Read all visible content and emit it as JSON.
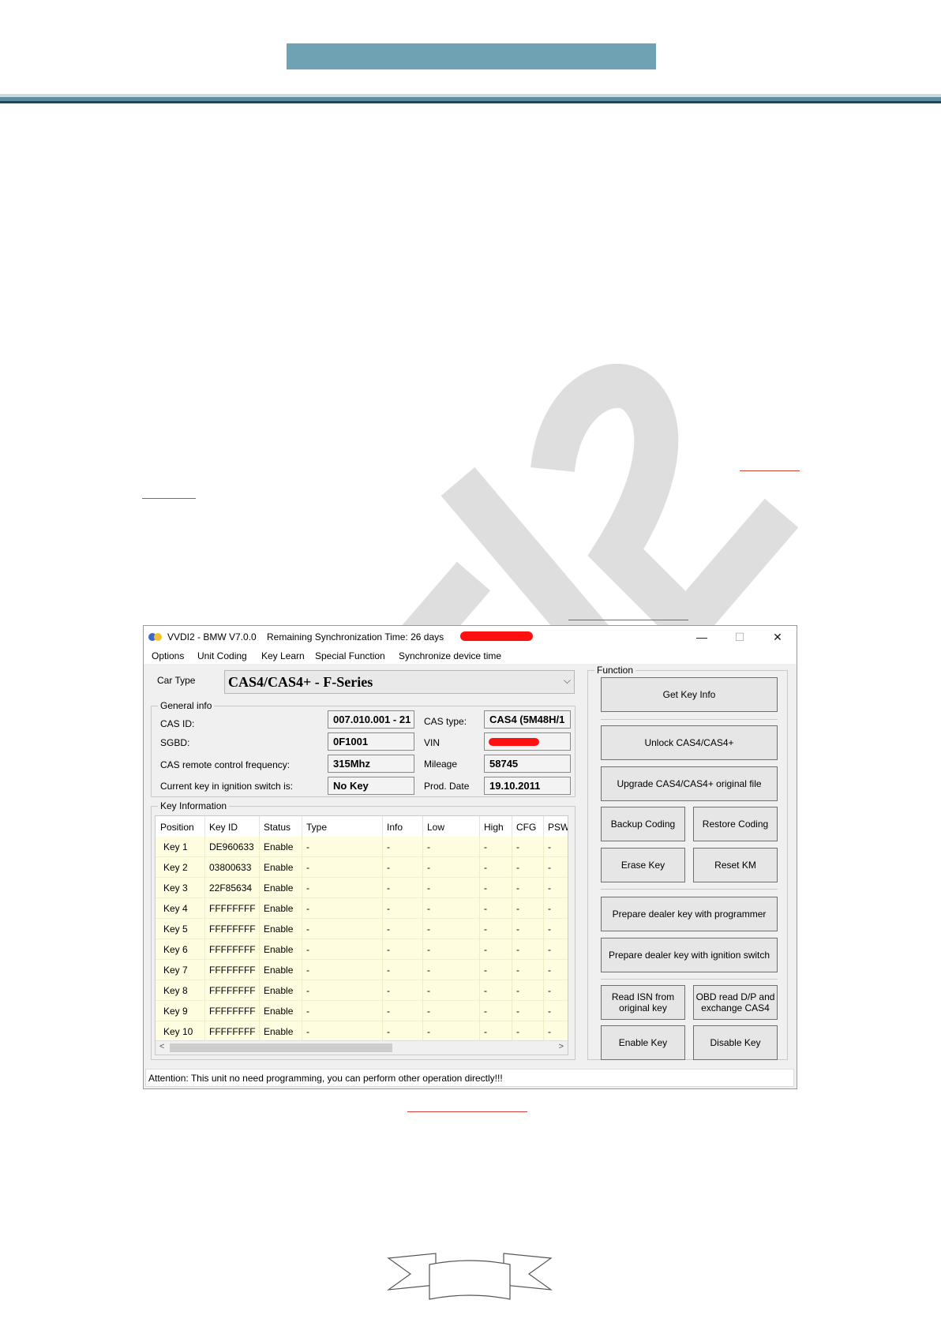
{
  "window": {
    "title": "VVDI2 - BMW V7.0.0",
    "sync_label": "Remaining Synchronization Time: 26 days",
    "minimize_glyph": "—",
    "maximize_glyph": "☐",
    "close_glyph": "✕"
  },
  "menu": [
    "Options",
    "Unit Coding",
    "Key Learn",
    "Special Function",
    "Synchronize device time"
  ],
  "car_type": {
    "label": "Car Type",
    "value": "CAS4/CAS4+ - F-Series",
    "chevron": "⌵"
  },
  "general_info": {
    "title": "General info",
    "cas_id_label": "CAS ID:",
    "cas_id_value": "007.010.001 - 21",
    "sgbd_label": "SGBD:",
    "sgbd_value": "0F1001",
    "frequency_label": "CAS remote control frequency:",
    "frequency_value": "315Mhz",
    "current_key_label": "Current key in ignition switch is:",
    "current_key_value": "No Key",
    "cas_type_label": "CAS type:",
    "cas_type_value": "CAS4 (5M48H/1",
    "vin_label": "VIN",
    "mileage_label": "Mileage",
    "mileage_value": "58745",
    "prod_date_label": "Prod. Date",
    "prod_date_value": "19.10.2011"
  },
  "key_information": {
    "title": "Key Information",
    "columns": [
      "Position",
      "Key ID",
      "Status",
      "Type",
      "Info",
      "Low",
      "High",
      "CFG",
      "PSW"
    ],
    "rows": [
      [
        "Key 1",
        "DE960633",
        "Enable",
        "-",
        "-",
        "-",
        "-",
        "-",
        "-"
      ],
      [
        "Key 2",
        "03800633",
        "Enable",
        "-",
        "-",
        "-",
        "-",
        "-",
        "-"
      ],
      [
        "Key 3",
        "22F85634",
        "Enable",
        "-",
        "-",
        "-",
        "-",
        "-",
        "-"
      ],
      [
        "Key 4",
        "FFFFFFFF",
        "Enable",
        "-",
        "-",
        "-",
        "-",
        "-",
        "-"
      ],
      [
        "Key 5",
        "FFFFFFFF",
        "Enable",
        "-",
        "-",
        "-",
        "-",
        "-",
        "-"
      ],
      [
        "Key 6",
        "FFFFFFFF",
        "Enable",
        "-",
        "-",
        "-",
        "-",
        "-",
        "-"
      ],
      [
        "Key 7",
        "FFFFFFFF",
        "Enable",
        "-",
        "-",
        "-",
        "-",
        "-",
        "-"
      ],
      [
        "Key 8",
        "FFFFFFFF",
        "Enable",
        "-",
        "-",
        "-",
        "-",
        "-",
        "-"
      ],
      [
        "Key 9",
        "FFFFFFFF",
        "Enable",
        "-",
        "-",
        "-",
        "-",
        "-",
        "-"
      ],
      [
        "Key 10",
        "FFFFFFFF",
        "Enable",
        "-",
        "-",
        "-",
        "-",
        "-",
        "-"
      ]
    ],
    "scroll_left_glyph": "<",
    "scroll_right_glyph": ">"
  },
  "function": {
    "title": "Function",
    "get_key_info": "Get Key Info",
    "unlock": "Unlock CAS4/CAS4+",
    "upgrade": "Upgrade CAS4/CAS4+ original file",
    "backup_coding": "Backup Coding",
    "restore_coding": "Restore Coding",
    "erase_key": "Erase Key",
    "reset_km": "Reset KM",
    "prepare_programmer": "Prepare dealer key with programmer",
    "prepare_ignition": "Prepare dealer key with ignition switch",
    "read_isn": "Read ISN from\noriginal key",
    "obd_read": "OBD read D/P and\nexchange CAS4",
    "enable_key": "Enable Key",
    "disable_key": "Disable Key"
  },
  "status": "Attention: This unit no need programming, you can perform other operation directly!!!",
  "colors": {
    "header_bar": "#6fa3b3",
    "redaction": "#ff1010",
    "link_underline": "#d9443b",
    "row_highlight": "#fffde0"
  }
}
